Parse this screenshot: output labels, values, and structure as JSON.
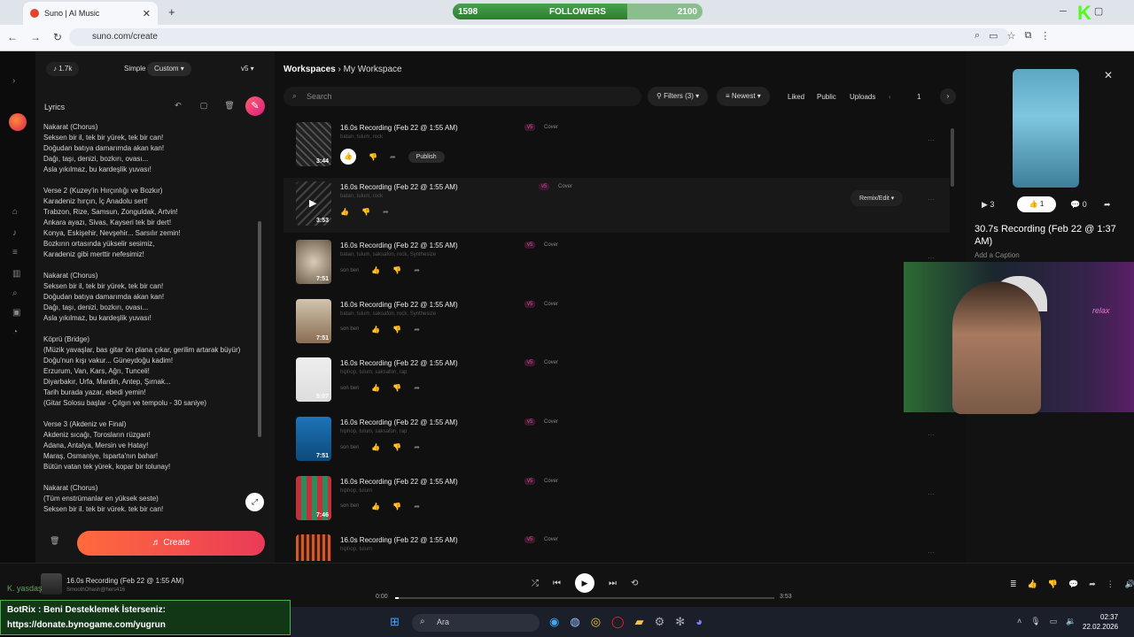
{
  "browser": {
    "tab_title": "Suno | AI Music",
    "tab_close": "✕",
    "new_tab": "+",
    "url": "suno.com/create",
    "followers": {
      "current": "1598",
      "label": "FOLLOWERS",
      "goal": "2100",
      "progress": 0.7
    }
  },
  "left": {
    "credits": "1.7k",
    "mode_simple": "Simple",
    "mode_custom": "Custom",
    "version": "v5",
    "lyrics_label": "Lyrics",
    "lyrics_text": "Nakarat (Chorus)\nSeksen bir il, tek bir yürek, tek bir can!\nDoğudan batıya damarımda akan kan!\nDağı, taşı, denizi, bozkırı, ovası...\nAsla yıkılmaz, bu kardeşlik yuvası!\n\nVerse 2 (Kuzey'in Hırçınlığı ve Bozkır)\nKaradeniz hırçın, İç Anadolu sert!\nTrabzon, Rize, Samsun, Zonguldak, Artvin!\nAnkara ayazı, Sivas, Kayseri tek bir dert!\nKonya, Eskişehir, Nevşehir... Sarsılır zemin!\nBozkırın ortasında yükselir sesimiz,\nKaradeniz gibi merttir nefesimiz!\n\nNakarat (Chorus)\nSeksen bir il, tek bir yürek, tek bir can!\nDoğudan batıya damarımda akan kan!\nDağı, taşı, denizi, bozkırı, ovası...\nAsla yıkılmaz, bu kardeşlik yuvası!\n\nKöprü (Bridge)\n(Müzik yavaşlar, bas gitar ön plana çıkar, gerilim artarak büyür)\nDoğu'nun kışı vakur... Güneydoğu kadim!\nErzurum, Van, Kars, Ağrı, Tunceli!\nDiyarbakır, Urfa, Mardin, Antep, Şırnak...\nTarih burada yazar, ebedi yemin!\n(Gitar Solosu başlar - Çılgın ve tempolu - 30 saniye)\n\nVerse 3 (Akdeniz ve Final)\nAkdeniz sıcağı, Torosların rüzgarı!\nAdana, Antalya, Mersin ve Hatay!\nMaraş, Osmaniye, Isparta'nın bahar!\nBütün vatan tek yürek, kopar bir tolunay!\n\nNakarat (Chorus)\n(Tüm enstrümanlar en yüksek seste)\nSeksen bir il, tek bir yürek, tek bir can!",
    "create_label": "Create"
  },
  "center": {
    "crumb_root": "Workspaces",
    "crumb_current": "My Workspace",
    "search_placeholder": "Search",
    "filters": "Filters (3)",
    "sort": "Newest",
    "liked": "Liked",
    "public": "Public",
    "uploads": "Uploads",
    "page": "1",
    "remix": "Remix/Edit",
    "songs": [
      {
        "title": "16.0s Recording (Feb 22 @ 1:55 AM)",
        "badge": "v5",
        "kind": "Cover",
        "tags": "batarı, tulum, rock",
        "duration": "3:44",
        "publish": "Publish"
      },
      {
        "title": "16.0s Recording (Feb 22 @ 1:55 AM)",
        "badge": "v5",
        "kind": "Cover",
        "tags": "batarı, tulum, rock",
        "duration": "3:53"
      },
      {
        "title": "16.0s Recording (Feb 22 @ 1:55 AM)",
        "badge": "v5",
        "kind": "Cover",
        "tags": "batarı, tulum, saksafon, rock, Synthesize",
        "duration": "7:51",
        "artist": "son ben"
      },
      {
        "title": "16.0s Recording (Feb 22 @ 1:55 AM)",
        "badge": "v5",
        "kind": "Cover",
        "tags": "batarı, tulum, saksafon, rock, Synthesize",
        "duration": "7:51",
        "artist": "son ben"
      },
      {
        "title": "16.0s Recording (Feb 22 @ 1:55 AM)",
        "badge": "v5",
        "kind": "Cover",
        "tags": "hiphop, tulum, saksafon, rap",
        "duration": "5:07",
        "artist": "son ben"
      },
      {
        "title": "16.0s Recording (Feb 22 @ 1:55 AM)",
        "badge": "v5",
        "kind": "Cover",
        "tags": "hiphop, tulum, saksafon, rap",
        "duration": "7:51",
        "artist": "son ben"
      },
      {
        "title": "16.0s Recording (Feb 22 @ 1:55 AM)",
        "badge": "v5",
        "kind": "Cover",
        "tags": "hiphop, tulum",
        "duration": "7:46",
        "artist": "son ben"
      },
      {
        "title": "16.0s Recording (Feb 22 @ 1:55 AM)",
        "badge": "v5",
        "kind": "Cover",
        "tags": "hiphop, tulum",
        "duration": ""
      }
    ]
  },
  "right": {
    "plays": "3",
    "likes": "1",
    "comments": "0",
    "title": "30.7s Recording (Feb 22 @ 1:37 AM)",
    "caption": "Add a Caption",
    "neon": "relax"
  },
  "player": {
    "title": "16.0s Recording (Feb 22 @ 1:55 AM)",
    "artist": "SmoothOhash@hers416",
    "time_current": "0:00",
    "time_total": "3:53",
    "progress": 0.01
  },
  "overlay": {
    "chat_line1": "BotRix : Beni Desteklemek İsterseniz:",
    "chat_line2": "https://donate.bynogame.com/yugrun",
    "ghost": "K. yasdaş"
  },
  "taskbar": {
    "search": "Ara",
    "time": "02:37",
    "date": "22.02.2026"
  }
}
